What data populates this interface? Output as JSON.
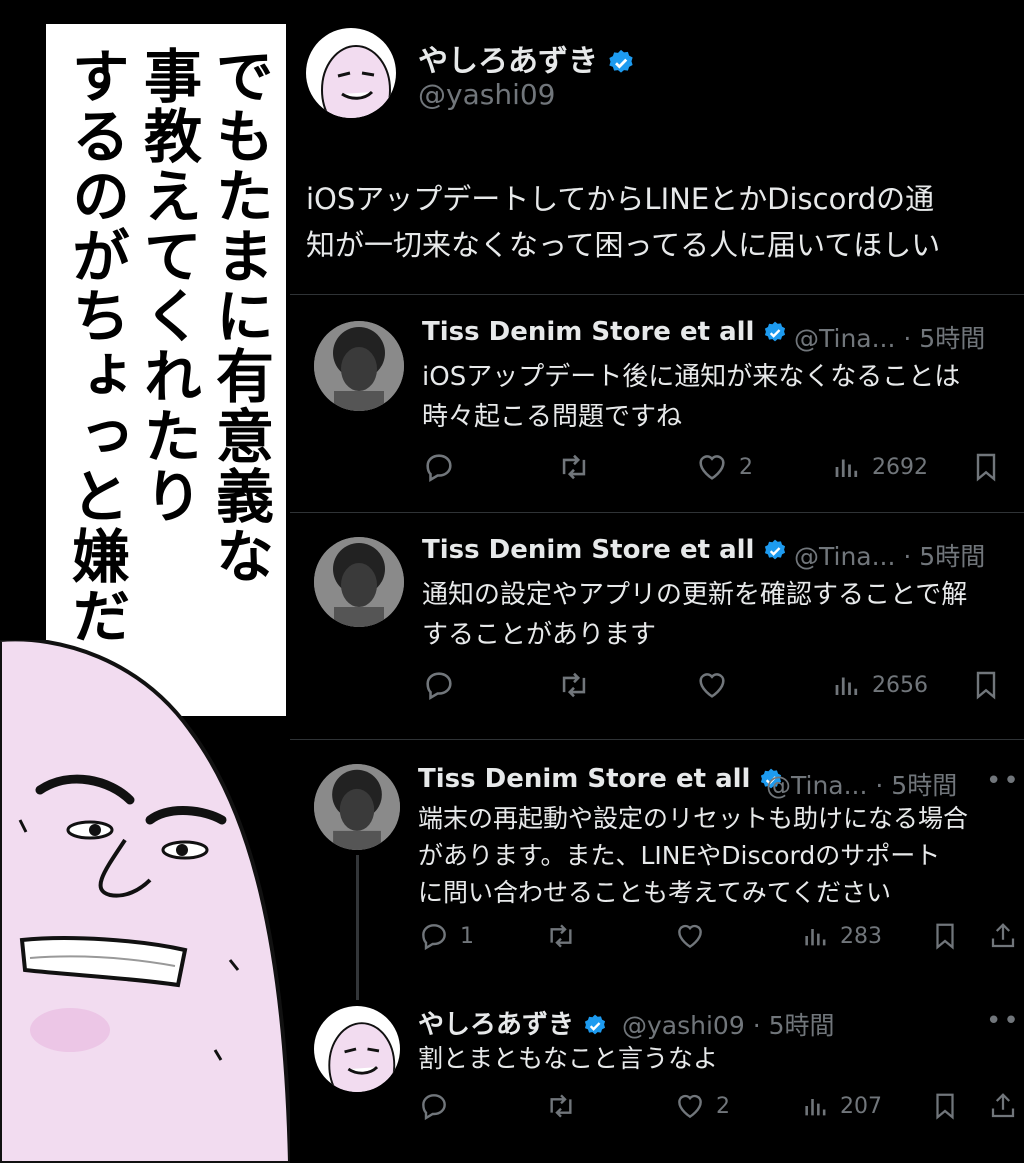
{
  "caption": "でもたまに有意義な\n事教えてくれたり\nするのがちょっと嫌だ",
  "main_post": {
    "name": "やしろあずき",
    "handle": "@yashi09",
    "text": "iOSアップデートしてからLINEとかDiscordの通\n知が一切来なくなって困ってる人に届いてほしい"
  },
  "replies": [
    {
      "name": "Tiss Denim Store et all",
      "meta": "@Tina... · 5時間",
      "text": "iOSアップデート後に通知が来なくなることは\n時々起こる問題ですね",
      "replies": "",
      "likes": "2",
      "views": "2692"
    },
    {
      "name": "Tiss Denim Store et all",
      "meta": "@Tina... · 5時間",
      "text": "通知の設定やアプリの更新を確認することで解\nすることがあります",
      "replies": "",
      "likes": "",
      "views": "2656"
    },
    {
      "name": "Tiss Denim Store et all",
      "meta": "@Tina... · 5時間",
      "text": "端末の再起動や設定のリセットも助けになる場合\nがあります。また、LINEやDiscordのサポート\nに問い合わせることも考えてみてください",
      "replies": "1",
      "likes": "",
      "views": "283",
      "more": "•••"
    },
    {
      "name": "やしろあずき",
      "meta": "@yashi09 · 5時間",
      "text": "割とまともなこと言うなよ",
      "replies": "",
      "likes": "2",
      "views": "207",
      "more": "•••"
    }
  ],
  "colors": {
    "background": "#000000",
    "text": "#e7e9ea",
    "muted": "#71767b",
    "verified": "#1d9bf0",
    "divider": "#2f3336",
    "character": "#f2dcf0"
  },
  "icons": [
    "verified-badge-icon",
    "reply-icon",
    "repost-icon",
    "like-icon",
    "views-icon",
    "bookmark-icon",
    "share-icon",
    "more-icon"
  ]
}
